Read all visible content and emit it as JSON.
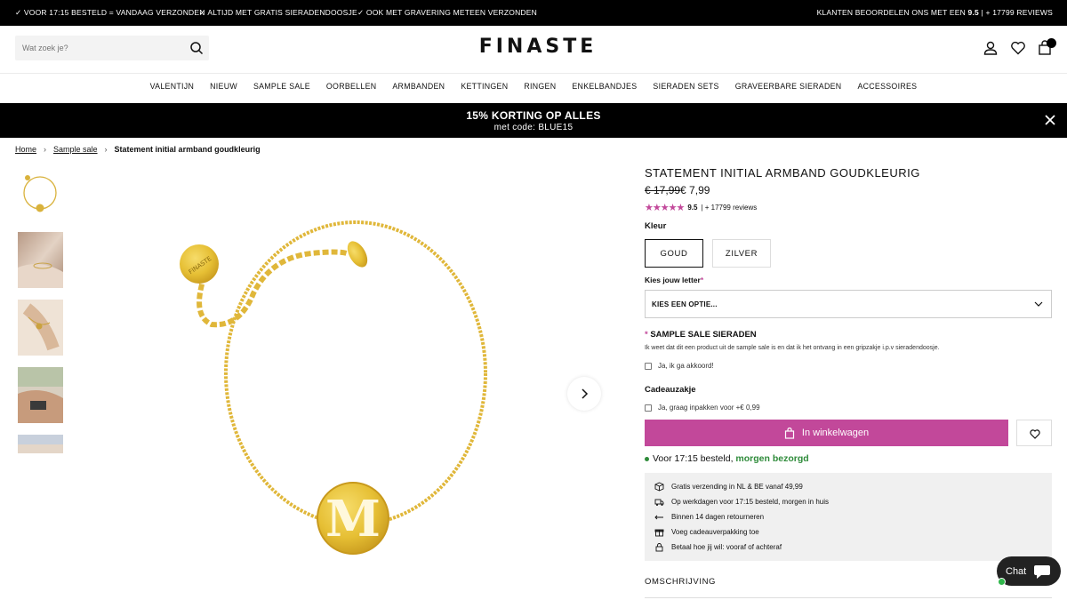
{
  "topbar": {
    "usps": [
      "✓ VOOR 17:15 BESTELD = VANDAAG VERZONDEN",
      "✓ ALTIJD MET GRATIS SIERADENDOOSJE",
      "✓ OOK MET GRAVERING METEEN VERZONDEN"
    ],
    "rating_prefix": "KLANTEN BEOORDELEN ONS MET EEN",
    "rating_value": "9.5",
    "rating_suffix": "| + 17799 REVIEWS"
  },
  "header": {
    "search_placeholder": "Wat zoek je?",
    "logo": "FINASTE"
  },
  "nav": [
    "VALENTIJN",
    "NIEUW",
    "SAMPLE SALE",
    "OORBELLEN",
    "ARMBANDEN",
    "KETTINGEN",
    "RINGEN",
    "ENKELBANDJES",
    "SIERADEN SETS",
    "GRAVEERBARE SIERADEN",
    "ACCESSOIRES"
  ],
  "promo": {
    "title": "15% KORTING OP ALLES",
    "subtitle": "met code: BLUE15"
  },
  "breadcrumb": {
    "home": "Home",
    "category": "Sample sale",
    "current": "Statement initial armband goudkleurig"
  },
  "product": {
    "title": "STATEMENT INITIAL ARMBAND GOUDKLEURIG",
    "price_old": "€ 17,99",
    "price_new": "€ 7,99",
    "stars": "★★★★★",
    "rating": "9.5",
    "reviews": "| + 17799 reviews",
    "color_label": "Kleur",
    "colors": [
      "GOUD",
      "ZILVER"
    ],
    "letter_label": "Kies jouw letter",
    "required_mark": "*",
    "letter_placeholder": "KIES EEN OPTIE...",
    "sample_title": "SAMPLE SALE SIERADEN",
    "sample_text": "Ik weet dat dit een product uit de sample sale is en dat ik het ontvang in een gripzakje i.p.v sieradendoosje.",
    "sample_check": "Ja, ik ga akkoord!",
    "gift_label": "Cadeauzakje",
    "gift_check": "Ja, graag inpakken voor +€ 0,99",
    "add_to_cart": "In winkelwagen",
    "delivery_prefix": "Voor 17:15 besteld,",
    "delivery_bold": "morgen bezorgd",
    "info": [
      "Gratis verzending in NL & BE vanaf 49,99",
      "Op werkdagen voor 17:15 besteld, morgen in huis",
      "Binnen 14 dagen retourneren",
      "Voeg cadeauverpakking toe",
      "Betaal hoe jij wil: vooraf of achteraf"
    ],
    "description_label": "OMSCHRIJVING",
    "pendant_letter": "M",
    "tag_text": "FINASTE"
  },
  "chat": {
    "label": "Chat"
  },
  "colors": {
    "accent": "#c2489a",
    "gold": "#e8c33a",
    "green": "#2e8b3a"
  }
}
